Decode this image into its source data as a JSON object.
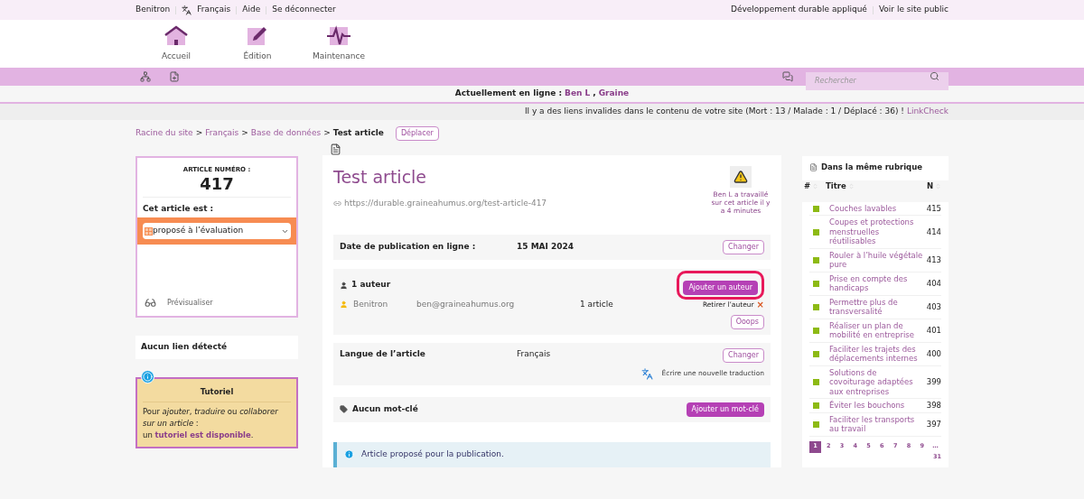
{
  "top_bar": {
    "left": [
      {
        "kind": "text",
        "label": "Benitron"
      },
      {
        "kind": "lang",
        "label": "Français"
      },
      {
        "kind": "text",
        "label": "Aide"
      },
      {
        "kind": "text",
        "label": "Se déconnecter"
      }
    ],
    "right": [
      "Développement durable appliqué",
      "Voir le site public"
    ]
  },
  "main_nav": [
    {
      "kind": "home",
      "label": "Accueil"
    },
    {
      "kind": "edit",
      "label": "Édition"
    },
    {
      "kind": "pulse",
      "label": "Maintenance"
    }
  ],
  "search": {
    "placeholder": "Rechercher"
  },
  "online": {
    "label": "Actuellement en ligne :",
    "users": [
      "Ben L",
      "Graine"
    ],
    "separator": ","
  },
  "link_warning": {
    "text": "Il y a des liens invalides dans le contenu de votre site (Mort : 13 / Malade : 1 / Déplacé : 36) !",
    "link": "LinkCheck"
  },
  "breadcrumb": {
    "items": [
      "Racine du site",
      "Français",
      "Base de données"
    ],
    "current": "Test article",
    "button": "Déplacer",
    "separator": ">"
  },
  "article_box": {
    "label": "ARTICLE NUMÉRO :",
    "number": "417",
    "status_label": "Cet article est :",
    "status": "proposé à l’évaluation",
    "preview": "Prévisualiser"
  },
  "links_box": "Aucun lien détecté",
  "tutorial": {
    "title": "Tutoriel",
    "text": "Pour *ajouter*, *traduire* ou *collaborer sur un article* :",
    "text2": "un",
    "link": "tutoriel est disponible",
    "end": "."
  },
  "article": {
    "title": "Test article",
    "url": "https://durable.graineahumus.org/test-article-417",
    "warning": "Ben L a travaillé sur cet article il y a 4 minutes",
    "date": {
      "label": "Date de publication en ligne :",
      "value": "15 MAI 2024",
      "button": "Changer"
    },
    "authors": {
      "label": "1 auteur",
      "button": "Ajouter un auteur",
      "highlighted": true,
      "rows": [
        {
          "name": "Benitron",
          "email": "ben@graineahumus.org",
          "count": "1 article",
          "remove": "Retirer l’auteur",
          "x": "×"
        }
      ],
      "undo": "Ooops"
    },
    "language": {
      "label": "Langue de l’article",
      "value": "Français",
      "button": "Changer",
      "translate": "Écrire une nouvelle traduction"
    },
    "keywords": {
      "label": "Aucun mot-clé",
      "button": "Ajouter un mot-clé"
    },
    "notice": "Article proposé pour la publication."
  },
  "rubrique": {
    "title": "Dans la même rubrique",
    "columns": [
      "#",
      "Titre",
      "N"
    ],
    "rows": [
      {
        "title": "Couches lavables",
        "n": "415"
      },
      {
        "title": "Coupes et protections menstruelles réutilisables",
        "n": "414"
      },
      {
        "title": "Rouler à l’huile végétale pure",
        "n": "413"
      },
      {
        "title": "Prise en compte des handicaps",
        "n": "404"
      },
      {
        "title": "Permettre plus de transversalité",
        "n": "403"
      },
      {
        "title": "Réaliser un plan de mobilité en entreprise",
        "n": "401"
      },
      {
        "title": "Faciliter les trajets des déplacements internes",
        "n": "400"
      },
      {
        "title": "Solutions de covoiturage adaptées aux entreprises",
        "n": "399"
      },
      {
        "title": "Éviter les bouchons",
        "n": "398"
      },
      {
        "title": "Faciliter les transports au travail",
        "n": "397"
      }
    ],
    "pages": [
      {
        "label": "1",
        "selected": true
      },
      {
        "label": "2",
        "selected": false
      },
      {
        "label": "3",
        "selected": false
      },
      {
        "label": "4",
        "selected": false
      },
      {
        "label": "5",
        "selected": false
      },
      {
        "label": "6",
        "selected": false
      },
      {
        "label": "7",
        "selected": false
      },
      {
        "label": "8",
        "selected": false
      },
      {
        "label": "9",
        "selected": false
      },
      {
        "label": "…",
        "selected": false
      }
    ],
    "last_page": "31"
  }
}
